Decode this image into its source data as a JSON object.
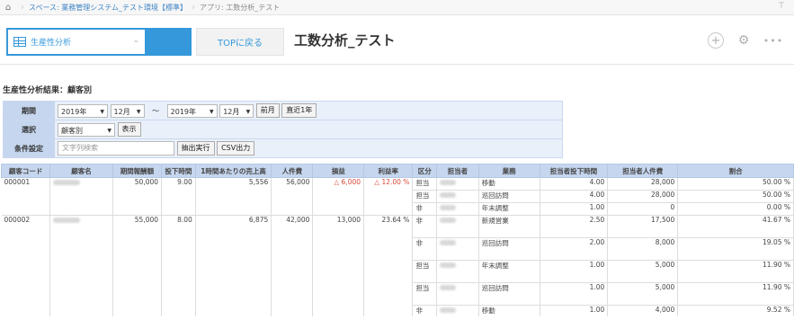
{
  "breadcrumb": {
    "space": "スペース: 業務管理システム_テスト環境【標準】",
    "app": "アプリ: 工数分析_テスト"
  },
  "header": {
    "view_name": "生産性分析",
    "top_button": "TOPに戻る",
    "title": "工数分析_テスト"
  },
  "section_title": "生産性分析結果：顧客別",
  "filter": {
    "period_label": "期間",
    "from_year": "2019年",
    "from_month": "12月",
    "tilde": "〜",
    "to_year": "2019年",
    "to_month": "12月",
    "prev_month": "前月",
    "last_year": "直近1年",
    "select_label": "選択",
    "select_value": "顧客別",
    "show": "表示",
    "cond_label": "条件設定",
    "search_placeholder": "文字列検索",
    "extract": "抽出実行",
    "csv": "CSV出力"
  },
  "table": {
    "headers": [
      "顧客コード",
      "顧客名",
      "期間報酬額",
      "投下時間",
      "1時間あたりの売上高",
      "人件費",
      "損益",
      "利益率",
      "区分",
      "担当者",
      "業務",
      "担当者投下時間",
      "担当者人件費",
      "割合"
    ],
    "rows": [
      [
        "000001",
        "",
        "50,000",
        "9.00",
        "5,556",
        "56,000",
        "△ 6,000",
        "△ 12.00 %",
        "担当",
        "",
        "移動",
        "4.00",
        "28,000",
        "50.00 %"
      ],
      [
        "",
        "",
        "",
        "",
        "",
        "",
        "",
        "",
        "担当",
        "",
        "巡回訪問",
        "4.00",
        "28,000",
        "50.00 %"
      ],
      [
        "",
        "",
        "",
        "",
        "",
        "",
        "",
        "",
        "非",
        "",
        "年末調整",
        "1.00",
        "0",
        "0.00 %"
      ],
      [
        "000002",
        "",
        "55,000",
        "8.00",
        "6,875",
        "42,000",
        "13,000",
        "23.64 %",
        "非",
        "",
        "新規営業",
        "2.50",
        "17,500",
        "41.67 %"
      ],
      [
        "",
        "",
        "",
        "",
        "",
        "",
        "",
        "",
        "",
        "",
        "",
        "",
        "",
        ""
      ],
      [
        "",
        "",
        "",
        "",
        "",
        "",
        "",
        "",
        "非",
        "",
        "巡回訪問",
        "2.00",
        "8,000",
        "19.05 %"
      ],
      [
        "",
        "",
        "",
        "",
        "",
        "",
        "",
        "",
        "",
        "",
        "",
        "",
        "",
        ""
      ],
      [
        "",
        "",
        "",
        "",
        "",
        "",
        "",
        "",
        "担当",
        "",
        "年末調整",
        "1.00",
        "5,000",
        "11.90 %"
      ],
      [
        "",
        "",
        "",
        "",
        "",
        "",
        "",
        "",
        "",
        "",
        "",
        "",
        "",
        ""
      ],
      [
        "",
        "",
        "",
        "",
        "",
        "",
        "",
        "",
        "担当",
        "",
        "巡回訪問",
        "1.00",
        "5,000",
        "11.90 %"
      ],
      [
        "",
        "",
        "",
        "",
        "",
        "",
        "",
        "",
        "",
        "",
        "",
        "",
        "",
        ""
      ],
      [
        "",
        "",
        "",
        "",
        "",
        "",
        "",
        "",
        "非",
        "",
        "移動",
        "1.00",
        "4,000",
        "9.52 %"
      ]
    ]
  },
  "colors": {
    "accent": "#3498db",
    "header_bg": "#c5d6ee",
    "filter_bg": "#e9f0fa",
    "negative": "#d84a3a"
  }
}
